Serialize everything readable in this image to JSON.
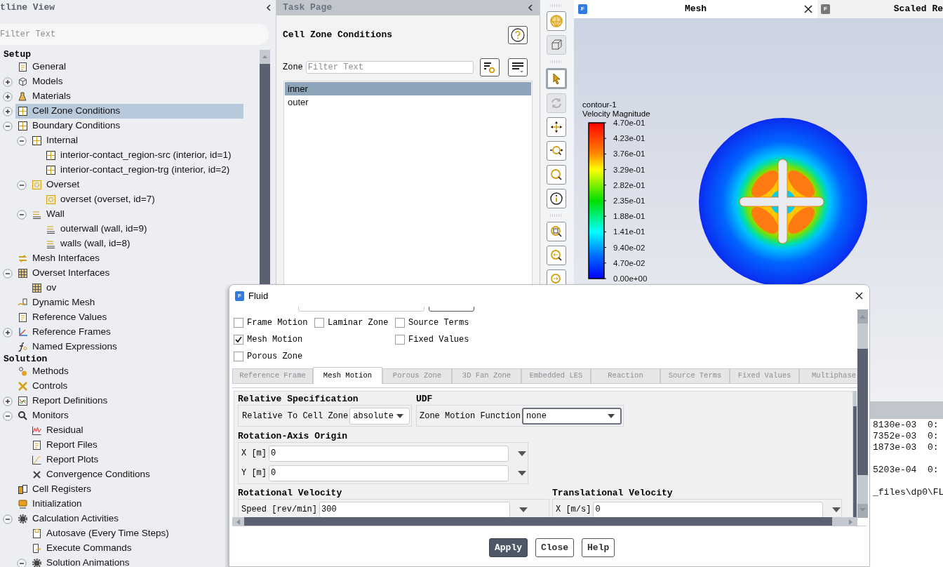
{
  "outline": {
    "title": "tline View",
    "filter": {
      "placeholder": "Filter Text"
    },
    "sections": [
      {
        "title": "Setup",
        "items": [
          {
            "label": "General",
            "selected": false
          },
          {
            "label": "Models",
            "expanded": false,
            "selected": false
          },
          {
            "label": "Materials",
            "expanded": false,
            "selected": false
          },
          {
            "label": "Cell Zone Conditions",
            "expanded": false,
            "selected": true
          },
          {
            "label": "Boundary Conditions",
            "expanded": true,
            "selected": false,
            "children": [
              {
                "label": "Internal",
                "expanded": true,
                "selected": false,
                "children": [
                  {
                    "label": "interior-contact_region-src (interior, id=1)",
                    "selected": false
                  },
                  {
                    "label": "interior-contact_region-trg (interior, id=2)",
                    "selected": false
                  }
                ]
              },
              {
                "label": "Overset",
                "expanded": true,
                "selected": false,
                "children": [
                  {
                    "label": "overset (overset, id=7)",
                    "selected": false
                  }
                ]
              },
              {
                "label": "Wall",
                "expanded": true,
                "selected": false,
                "children": [
                  {
                    "label": "outerwall (wall, id=9)",
                    "selected": false
                  },
                  {
                    "label": "walls (wall, id=8)",
                    "selected": false
                  }
                ]
              }
            ]
          },
          {
            "label": "Mesh Interfaces",
            "selected": false
          },
          {
            "label": "Overset Interfaces",
            "expanded": true,
            "selected": false,
            "children": [
              {
                "label": "ov",
                "selected": false
              }
            ]
          },
          {
            "label": "Dynamic Mesh",
            "selected": false
          },
          {
            "label": "Reference Values",
            "selected": false
          },
          {
            "label": "Reference Frames",
            "expanded": false,
            "selected": false
          },
          {
            "label": "Named Expressions",
            "selected": false
          }
        ]
      },
      {
        "title": "Solution",
        "items": [
          {
            "label": "Methods",
            "selected": false
          },
          {
            "label": "Controls",
            "selected": false
          },
          {
            "label": "Report Definitions",
            "expanded": false,
            "selected": false
          },
          {
            "label": "Monitors",
            "expanded": true,
            "selected": false,
            "children": [
              {
                "label": "Residual",
                "selected": false
              },
              {
                "label": "Report Files",
                "selected": false
              },
              {
                "label": "Report Plots",
                "selected": false
              },
              {
                "label": "Convergence Conditions",
                "selected": false
              }
            ]
          },
          {
            "label": "Cell Registers",
            "selected": false
          },
          {
            "label": "Initialization",
            "selected": false
          },
          {
            "label": "Calculation Activities",
            "expanded": true,
            "selected": false,
            "children": [
              {
                "label": "Autosave (Every Time Steps)",
                "selected": false
              },
              {
                "label": "Execute Commands",
                "selected": false
              },
              {
                "label": "Solution Animations",
                "expanded": true,
                "selected": false
              }
            ]
          }
        ]
      }
    ]
  },
  "task_page": {
    "title": "Task Page",
    "heading": "Cell Zone Conditions",
    "zone_label": "Zone",
    "filter": {
      "placeholder": "Filter Text"
    },
    "zones": [
      {
        "label": "inner",
        "selected": true
      },
      {
        "label": "outer",
        "selected": false
      }
    ]
  },
  "toolbar": {
    "buttons": [
      {
        "selected": false,
        "disabled": false
      },
      {
        "selected": false,
        "disabled": true
      },
      {
        "selected": true,
        "disabled": false
      },
      {
        "selected": false,
        "disabled": true
      },
      {
        "selected": false,
        "disabled": false
      },
      {
        "selected": false,
        "disabled": false
      },
      {
        "selected": false,
        "disabled": false
      },
      {
        "selected": false,
        "disabled": false
      },
      {
        "selected": false,
        "disabled": false
      },
      {
        "selected": false,
        "disabled": false
      },
      {
        "selected": false,
        "disabled": false
      }
    ]
  },
  "graphics": {
    "tabs": [
      {
        "badge": "F",
        "title": "Mesh",
        "selected": true
      },
      {
        "badge": "F",
        "title": "Scaled Re",
        "selected": false
      }
    ],
    "legend": {
      "title": "contour-1",
      "subtitle": "Velocity Magnitude",
      "labels": [
        "4.70e-01",
        "4.23e-01",
        "3.76e-01",
        "3.29e-01",
        "2.82e-01",
        "2.35e-01",
        "1.88e-01",
        "1.41e-01",
        "9.40e-02",
        "4.70e-02",
        "0.00e+00"
      ]
    }
  },
  "console": {
    "lines": [
      "8130e-03  0:",
      "7352e-03  0:",
      "1873e-03  0:",
      "5203e-04  0:",
      "_files\\dp0\\FL"
    ]
  },
  "dialog": {
    "badge": "F",
    "title": "Fluid",
    "checkboxes": [
      {
        "label": "Frame Motion",
        "checked": false
      },
      {
        "label": "Laminar Zone",
        "checked": false
      },
      {
        "label": "Source Terms",
        "checked": false
      },
      {
        "label": "Mesh Motion",
        "checked": true
      },
      {
        "label": "Fixed Values",
        "checked": false
      },
      {
        "label": "Porous Zone",
        "checked": false
      }
    ],
    "tabs": [
      {
        "label": "Reference Frame",
        "selected": false
      },
      {
        "label": "Mesh Motion",
        "selected": true
      },
      {
        "label": "Porous Zone",
        "selected": false
      },
      {
        "label": "3D Fan Zone",
        "selected": false
      },
      {
        "label": "Embedded LES",
        "selected": false
      },
      {
        "label": "Reaction",
        "selected": false
      },
      {
        "label": "Source Terms",
        "selected": false
      },
      {
        "label": "Fixed Values",
        "selected": false
      },
      {
        "label": "Multiphase",
        "selected": false
      }
    ],
    "relative_specification": {
      "title": "Relative Specification",
      "label": "Relative To Cell Zone",
      "value": "absolute"
    },
    "udf": {
      "title": "UDF",
      "label": "Zone Motion Function",
      "value": "none"
    },
    "rotation_axis_origin": {
      "title": "Rotation-Axis Origin",
      "fields": [
        {
          "label": "X [m]",
          "value": "0"
        },
        {
          "label": "Y [m]",
          "value": "0"
        }
      ]
    },
    "rotational_velocity": {
      "title": "Rotational Velocity",
      "fields": [
        {
          "label": "Speed [rev/min]",
          "value": "300"
        }
      ]
    },
    "translational_velocity": {
      "title": "Translational Velocity",
      "fields": [
        {
          "label": "X [m/s]",
          "value": "0"
        }
      ]
    },
    "buttons": [
      {
        "label": "Apply",
        "kind": "primary"
      },
      {
        "label": "Close",
        "kind": "normal"
      },
      {
        "label": "Help",
        "kind": "normal"
      }
    ]
  }
}
